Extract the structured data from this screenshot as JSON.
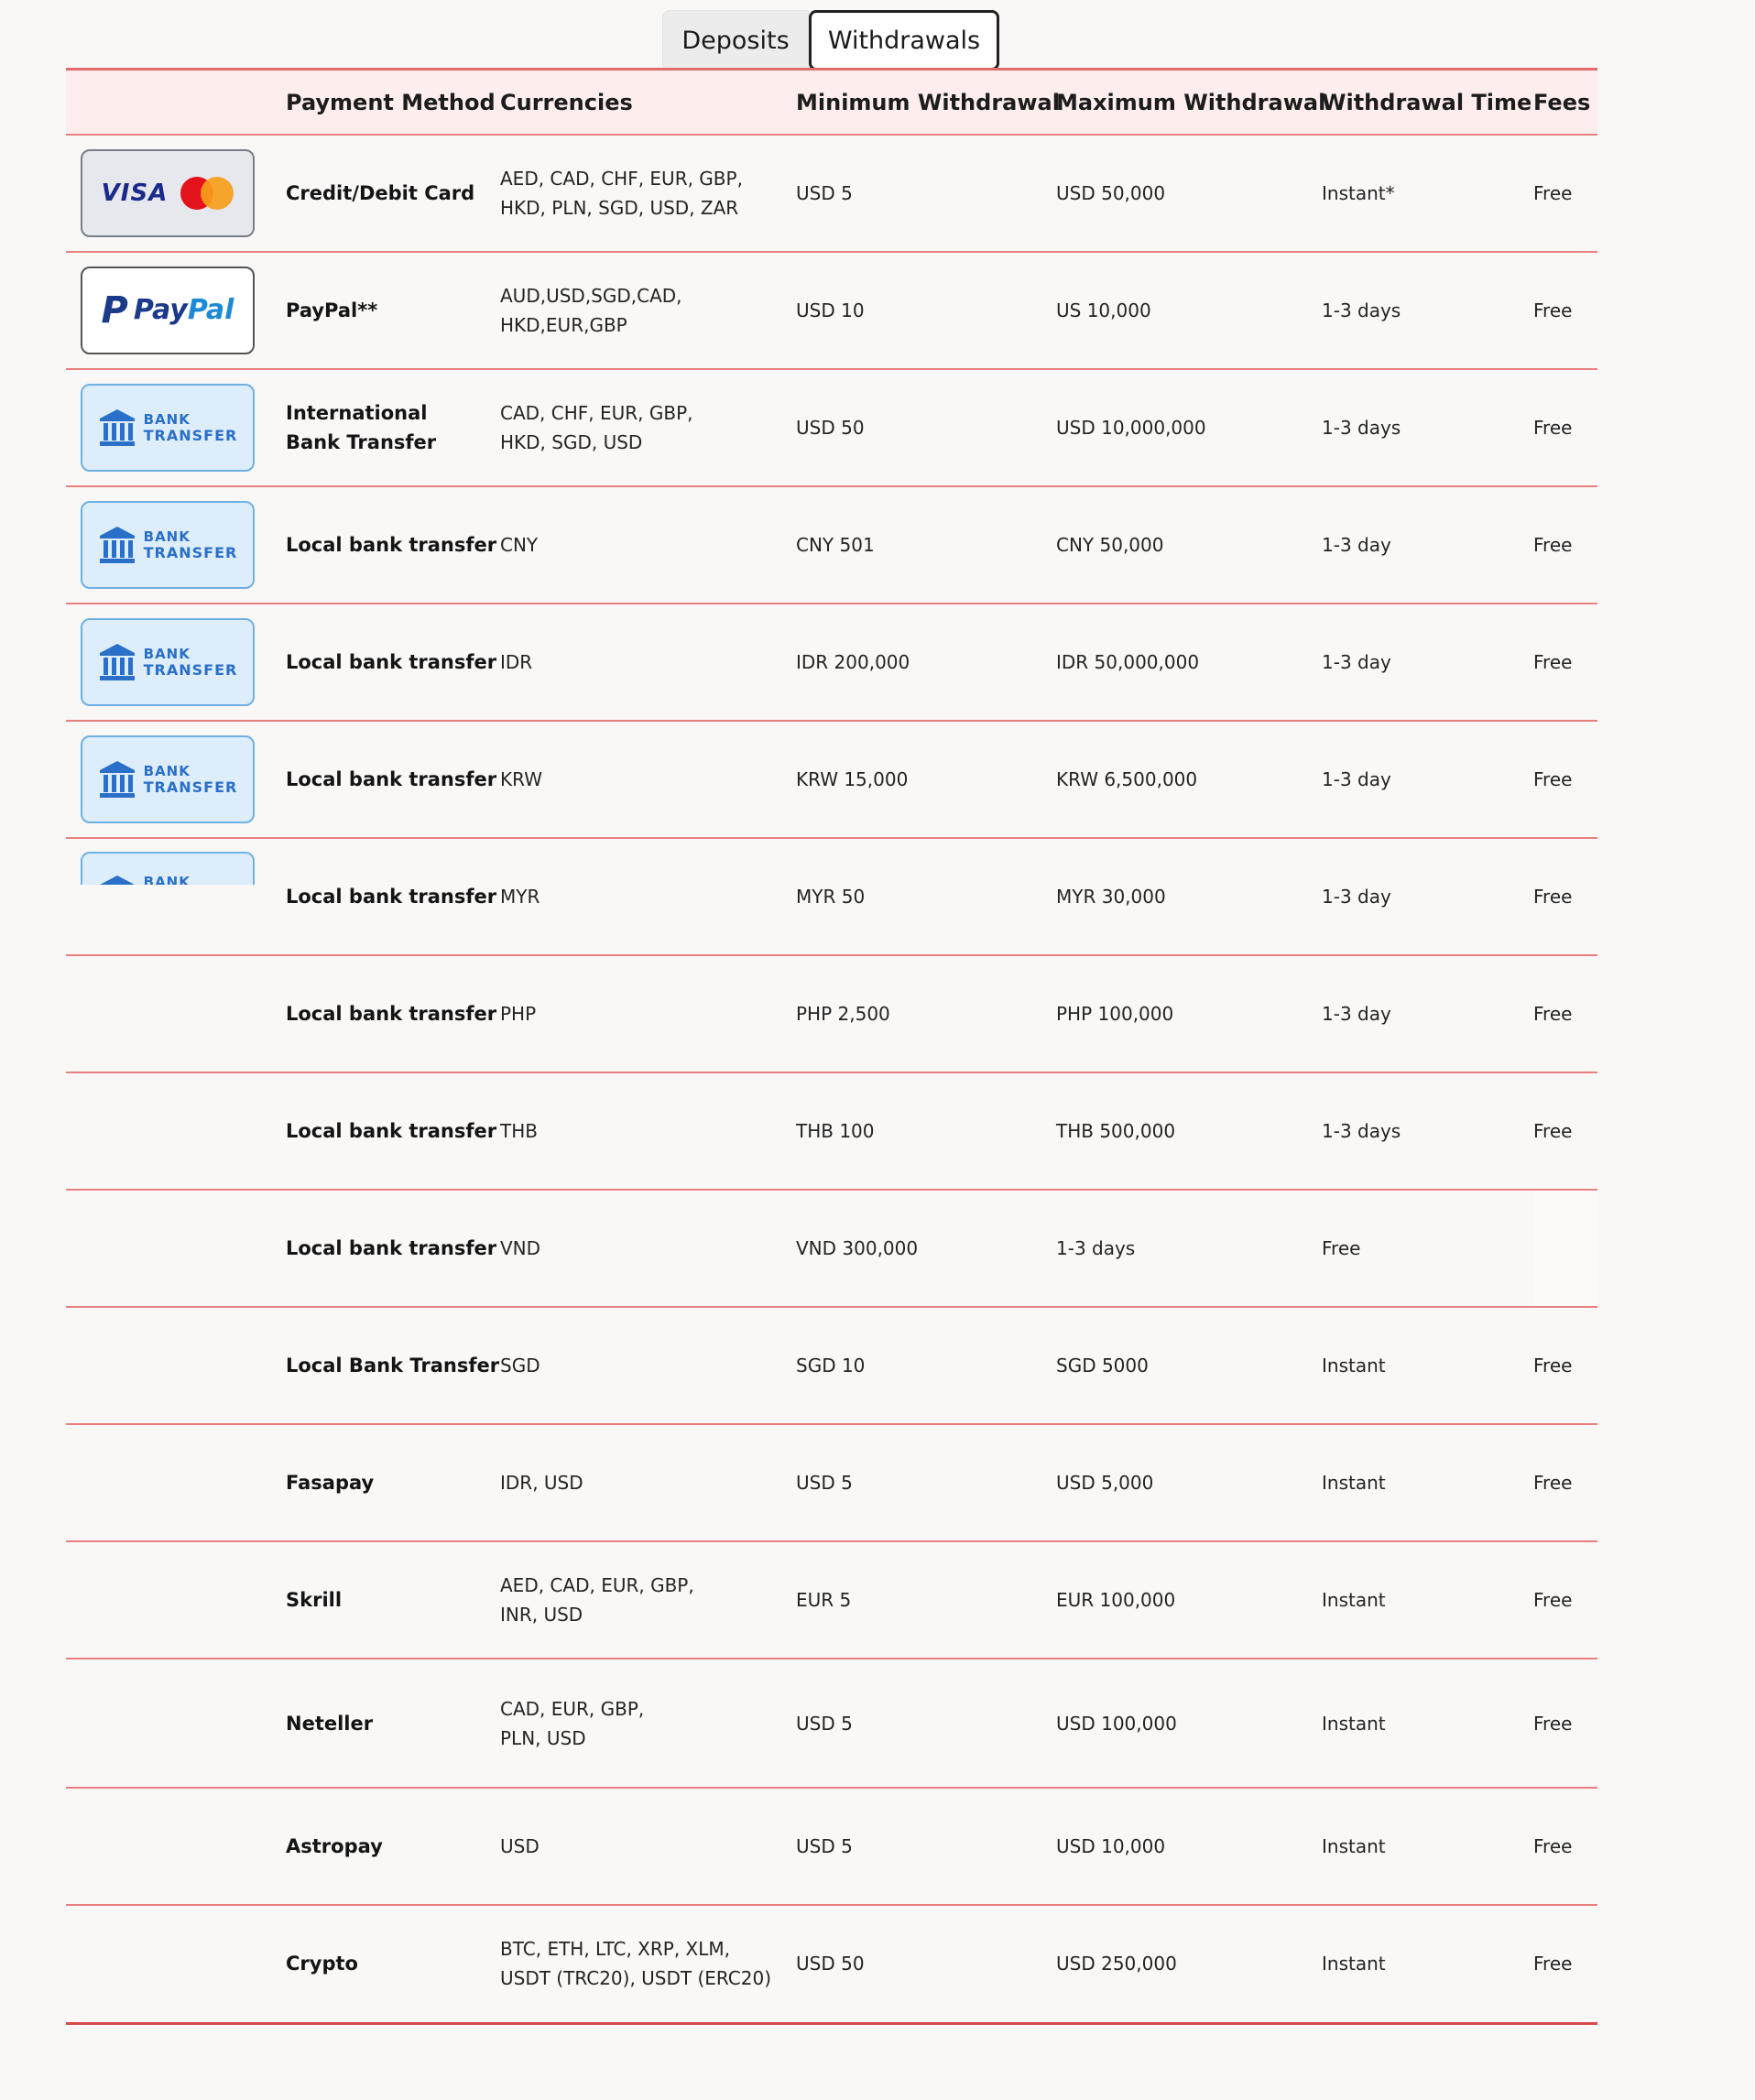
{
  "tabs": [
    {
      "label": "Deposits",
      "active": false
    },
    {
      "label": "Withdrawals",
      "active": true
    }
  ],
  "colors": {
    "row_border": "#e87e7e",
    "header_bg": "#fdeeed",
    "bank_logo_blue": "#2a6fc8",
    "visa_blue": "#1a2a8a",
    "mastercard_red": "#e4121d",
    "mastercard_orange": "#f79e1b"
  },
  "table": {
    "headers": {
      "logo": "",
      "payment_method": "Payment Method",
      "currencies": "Currencies",
      "min": "Minimum Withdrawal",
      "max": "Maximum Withdrawal",
      "time": "Withdrawal Time",
      "fees": "Fees"
    },
    "logos": {
      "card": {
        "visa": "VISA",
        "icon": "mastercard-icon"
      },
      "paypal": {
        "p": "P",
        "pay": "Pay",
        "pal": "Pal"
      },
      "bank": {
        "line1": "BANK",
        "line2": "TRANSFER",
        "icon": "bank-building-icon"
      }
    },
    "rows": [
      {
        "logo": "card",
        "method": "Credit/Debit Card",
        "currencies": [
          "AED, CAD, CHF, EUR, GBP,",
          "HKD, PLN, SGD, USD, ZAR"
        ],
        "min": "USD 5",
        "max": "USD 50,000",
        "time": "Instant*",
        "fees": "Free"
      },
      {
        "logo": "paypal",
        "method": "PayPal**",
        "currencies": [
          "AUD,USD,SGD,CAD,",
          "HKD,EUR,GBP"
        ],
        "min": "USD 10",
        "max": "US 10,000",
        "time": "1-3 days",
        "fees": "Free"
      },
      {
        "logo": "bank",
        "method_lines": [
          "International",
          "Bank Transfer"
        ],
        "currencies": [
          "CAD, CHF, EUR, GBP,",
          "HKD, SGD, USD"
        ],
        "min": "USD 50",
        "max": "USD 10,000,000",
        "time": "1-3 days",
        "fees": "Free"
      },
      {
        "logo": "bank",
        "method": "Local bank transfer",
        "currencies": [
          "CNY"
        ],
        "min": "CNY 501",
        "max": "CNY 50,000",
        "time": "1-3 day",
        "fees": "Free"
      },
      {
        "logo": "bank",
        "method": "Local bank transfer",
        "currencies": [
          "IDR"
        ],
        "min": "IDR 200,000",
        "max": "IDR 50,000,000",
        "time": "1-3 day",
        "fees": "Free"
      },
      {
        "logo": "bank",
        "method": "Local bank transfer",
        "currencies": [
          "KRW"
        ],
        "min": "KRW 15,000",
        "max": "KRW 6,500,000",
        "time": "1-3 day",
        "fees": "Free"
      },
      {
        "logo": "bank-partial",
        "method": "Local bank transfer",
        "currencies": [
          "MYR"
        ],
        "min": "MYR 50",
        "max": "MYR 30,000",
        "time": "1-3 day",
        "fees": "Free"
      },
      {
        "logo": "",
        "method": "Local bank transfer",
        "currencies": [
          "PHP"
        ],
        "min": "PHP 2,500",
        "max": "PHP 100,000",
        "time": "1-3 day",
        "fees": "Free"
      },
      {
        "logo": "",
        "method": "Local bank transfer",
        "currencies": [
          "THB"
        ],
        "min": "THB 100",
        "max": "THB 500,000",
        "time": "1-3 days",
        "fees": "Free"
      },
      {
        "logo": "",
        "method": "Local bank transfer",
        "currencies": [
          "VND"
        ],
        "min": "VND 300,000",
        "max": "1-3 days",
        "time": "Free",
        "fees": ""
      },
      {
        "logo": "",
        "method": "Local Bank Transfer",
        "currencies": [
          "SGD"
        ],
        "min": "SGD 10",
        "max": "SGD 5000",
        "time": "Instant",
        "fees": "Free"
      },
      {
        "logo": "",
        "method": "Fasapay",
        "currencies": [
          "IDR, USD"
        ],
        "min": "USD 5",
        "max": "USD 5,000",
        "time": "Instant",
        "fees": "Free"
      },
      {
        "logo": "",
        "method": "Skrill",
        "currencies": [
          "AED, CAD, EUR, GBP,",
          "INR, USD"
        ],
        "min": "EUR 5",
        "max": "EUR 100,000",
        "time": "Instant",
        "fees": "Free"
      },
      {
        "logo": "",
        "method": "Neteller",
        "currencies": [
          "CAD, EUR, GBP,",
          "PLN, USD"
        ],
        "min": "USD 5",
        "max": "USD 100,000",
        "time": "Instant",
        "fees": "Free"
      },
      {
        "logo": "",
        "method": "Astropay",
        "currencies": [
          "USD"
        ],
        "min": "USD 5",
        "max": "USD 10,000",
        "time": "Instant",
        "fees": "Free"
      },
      {
        "logo": "",
        "method": "Crypto",
        "currencies": [
          "BTC, ETH, LTC, XRP, XLM,",
          "USDT (TRC20), USDT (ERC20)"
        ],
        "min": "USD 50",
        "max": "USD 250,000",
        "time": "Instant",
        "fees": "Free"
      }
    ]
  }
}
